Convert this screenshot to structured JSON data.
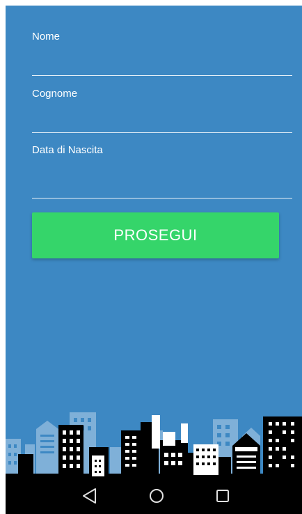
{
  "form": {
    "nome_label": "Nome",
    "nome_value": "",
    "cognome_label": "Cognome",
    "cognome_value": "",
    "nascita_label": "Data di Nascita",
    "nascita_value": ""
  },
  "proceed_button": {
    "label": "PROSEGUI"
  },
  "navbar": {
    "icons": [
      "back-icon",
      "home-icon",
      "recent-apps-icon"
    ]
  },
  "colors": {
    "background": "#3d88c3",
    "button": "#35d56a",
    "text": "#ffffff",
    "navbar": "#000000"
  }
}
